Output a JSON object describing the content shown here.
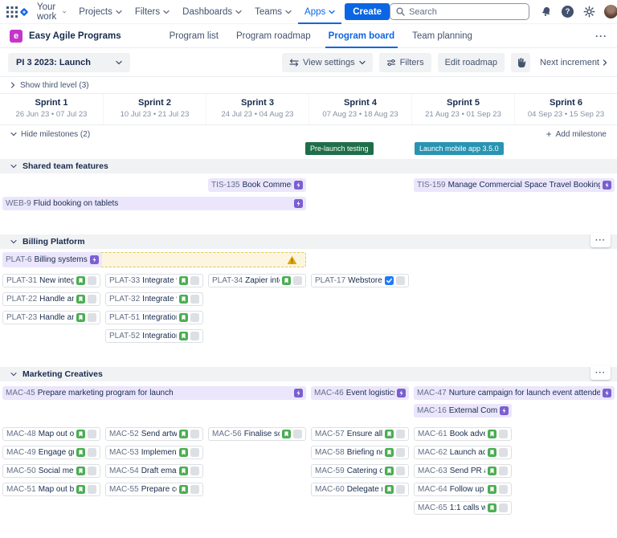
{
  "topnav": {
    "menu": [
      "Your work",
      "Projects",
      "Filters",
      "Dashboards",
      "Teams",
      "Apps"
    ],
    "create_label": "Create",
    "search_placeholder": "Search"
  },
  "appbar": {
    "logo_letter": "e",
    "title": "Easy Agile Programs",
    "tabs": [
      "Program list",
      "Program roadmap",
      "Program board",
      "Team planning"
    ],
    "active_tab": "Program board"
  },
  "ui": {
    "more_dots": "···"
  },
  "toolbar": {
    "pi_selector": "PI 3 2023: Launch",
    "view_settings": "View settings",
    "filters": "Filters",
    "edit_roadmap": "Edit roadmap",
    "next_increment": "Next increment"
  },
  "board": {
    "third_level_toggle": "Show third level (3)",
    "milestones_toggle": "Hide milestones (2)",
    "add_milestone": "Add milestone",
    "sprints": [
      {
        "name": "Sprint 1",
        "dates": "26 Jun 23 • 07 Jul 23"
      },
      {
        "name": "Sprint 2",
        "dates": "10 Jul 23 • 21 Jul 23"
      },
      {
        "name": "Sprint 3",
        "dates": "24 Jul 23 • 04 Aug 23"
      },
      {
        "name": "Sprint 4",
        "dates": "07 Aug 23 • 18 Aug 23"
      },
      {
        "name": "Sprint 5",
        "dates": "21 Aug 23 • 01 Sep 23"
      },
      {
        "name": "Sprint 6",
        "dates": "04 Sep 23 • 15 Sep 23"
      }
    ],
    "milestones": [
      {
        "label": "Pre-launch testing",
        "color": "#1F6E4A"
      },
      {
        "label": "Launch mobile app 3.5.0",
        "color": "#2994B2"
      }
    ]
  },
  "sections": {
    "shared": {
      "title": "Shared team features",
      "epics": [
        {
          "key": "TIS-135",
          "summary": "Book Commerci...",
          "type": "epic"
        },
        {
          "key": "TIS-159",
          "summary": "Manage Commercial Space Travel Booking",
          "type": "epic"
        },
        {
          "key": "WEB-9",
          "summary": "Fluid booking on tablets",
          "type": "epic"
        }
      ]
    },
    "billing": {
      "title": "Billing Platform",
      "epic": {
        "key": "PLAT-6",
        "summary": "Billing systems i...",
        "type": "epic",
        "status": "warning"
      },
      "tasks": [
        {
          "key": "PLAT-31",
          "summary": "New integrat...",
          "type": "story"
        },
        {
          "key": "PLAT-22",
          "summary": "Handle and ...",
          "type": "story"
        },
        {
          "key": "PLAT-23",
          "summary": "Handle and ...",
          "type": "story"
        },
        {
          "key": "PLAT-33",
          "summary": "Integrate wit...",
          "type": "story"
        },
        {
          "key": "PLAT-32",
          "summary": "Integrate wit...",
          "type": "story"
        },
        {
          "key": "PLAT-51",
          "summary": "Integration w...",
          "type": "story"
        },
        {
          "key": "PLAT-52",
          "summary": "Integration w...",
          "type": "story"
        },
        {
          "key": "PLAT-34",
          "summary": "Zapier integr...",
          "type": "story"
        },
        {
          "key": "PLAT-17",
          "summary": "Webstore pu...",
          "type": "done"
        }
      ]
    },
    "marketing": {
      "title": "Marketing Creatives",
      "epics": [
        {
          "key": "MAC-45",
          "summary": "Prepare marketing program for launch",
          "type": "epic"
        },
        {
          "key": "MAC-46",
          "summary": "Event logistics f...",
          "type": "epic"
        },
        {
          "key": "MAC-47",
          "summary": "Nurture campaign for launch event attendees",
          "type": "epic"
        },
        {
          "key": "MAC-16",
          "summary": "External Comm...",
          "type": "epic"
        }
      ],
      "tasks": [
        {
          "key": "MAC-48",
          "summary": "Map out offli...",
          "type": "story"
        },
        {
          "key": "MAC-49",
          "summary": "Engage grap...",
          "type": "story"
        },
        {
          "key": "MAC-50",
          "summary": "Social media...",
          "type": "story"
        },
        {
          "key": "MAC-51",
          "summary": "Map out bud...",
          "type": "story"
        },
        {
          "key": "MAC-52",
          "summary": "Send artwork...",
          "type": "story"
        },
        {
          "key": "MAC-53",
          "summary": "Implement ta...",
          "type": "story"
        },
        {
          "key": "MAC-54",
          "summary": "Draft email in...",
          "type": "story"
        },
        {
          "key": "MAC-55",
          "summary": "Prepare com...",
          "type": "story"
        },
        {
          "key": "MAC-56",
          "summary": "Finalise soci...",
          "type": "story"
        },
        {
          "key": "MAC-57",
          "summary": "Ensure all thi...",
          "type": "story"
        },
        {
          "key": "MAC-58",
          "summary": "Briefing note ...",
          "type": "story"
        },
        {
          "key": "MAC-59",
          "summary": "Catering ord...",
          "type": "story"
        },
        {
          "key": "MAC-60",
          "summary": "Delegate me...",
          "type": "story"
        },
        {
          "key": "MAC-61",
          "summary": "Book adverti...",
          "type": "story"
        },
        {
          "key": "MAC-62",
          "summary": "Launch adve...",
          "type": "story"
        },
        {
          "key": "MAC-63",
          "summary": "Send PR arti...",
          "type": "story"
        },
        {
          "key": "MAC-64",
          "summary": "Follow up e...",
          "type": "story"
        },
        {
          "key": "MAC-65",
          "summary": "1:1 calls with...",
          "type": "story"
        }
      ]
    }
  },
  "colors": {
    "accent_blue": "#0C66E4",
    "epic_purple": "#7A5FD0",
    "story_green": "#4BAD52",
    "done_blue": "#1D7AFC",
    "warning_yellow": "#E2A300",
    "milestone_green": "#1F6E4A",
    "milestone_teal": "#2994B2",
    "easy_agile_magenta": "#C436C9"
  }
}
